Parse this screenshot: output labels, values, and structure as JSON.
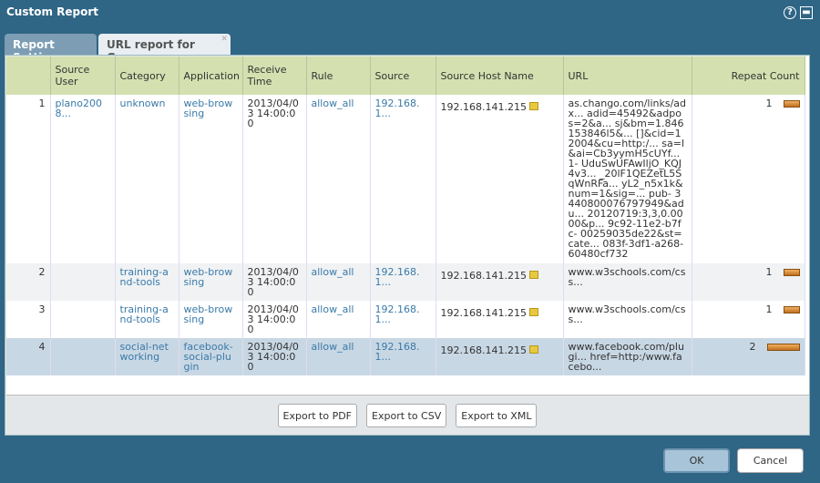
{
  "window": {
    "title": "Custom Report"
  },
  "tabs": [
    {
      "label": "Report Setting"
    },
    {
      "label": "URL report for Group"
    }
  ],
  "columns": [
    "",
    "Source User",
    "Category",
    "Application",
    "Receive Time",
    "Rule",
    "Source",
    "Source Host Name",
    "URL",
    "Repeat Count"
  ],
  "rows": [
    {
      "n": "1",
      "user": "plano2008...",
      "category": "unknown",
      "app": "web-browsing",
      "time": "2013/04/03 14:00:00",
      "rule": "allow_all",
      "source": "192.168.1...",
      "host": "192.168.141.215",
      "url": "as.chango.com/links/adx... adid=45492&adpos=2&a... sj&bm=1.846153846l5&... []&cid=12004&cu=http:/... sa=l&ai=Cb3yymH5cUYf... 1- UduSwUFAwIljO_KQJ4v3... _20lF1QEZetL5SqWnRFa... yL2_n5x1k&num=1&sig=... pub- 3440800076797949&adu... 20120719:3,3,0.0000&p... 9c92-11e2-b7fc- 00259035de22&st=cate... 083f-3df1-a268- 60480cf732",
      "count": 1
    },
    {
      "n": "2",
      "user": "",
      "category": "training-and-tools",
      "app": "web-browsing",
      "time": "2013/04/03 14:00:00",
      "rule": "allow_all",
      "source": "192.168.1...",
      "host": "192.168.141.215",
      "url": "www.w3schools.com/css...",
      "count": 1
    },
    {
      "n": "3",
      "user": "",
      "category": "training-and-tools",
      "app": "web-browsing",
      "time": "2013/04/03 14:00:00",
      "rule": "allow_all",
      "source": "192.168.1...",
      "host": "192.168.141.215",
      "url": "www.w3schools.com/css...",
      "count": 1
    },
    {
      "n": "4",
      "user": "",
      "category": "social-networking",
      "app": "facebook-social-plugin",
      "time": "2013/04/03 14:00:00",
      "rule": "allow_all",
      "source": "192.168.1...",
      "host": "192.168.141.215",
      "url": "www.facebook.com/plugi... href=http:/www.facebo...",
      "count": 2
    }
  ],
  "export_buttons": [
    "Export to PDF",
    "Export to CSV",
    "Export to XML"
  ],
  "footer": {
    "ok": "OK",
    "cancel": "Cancel"
  }
}
